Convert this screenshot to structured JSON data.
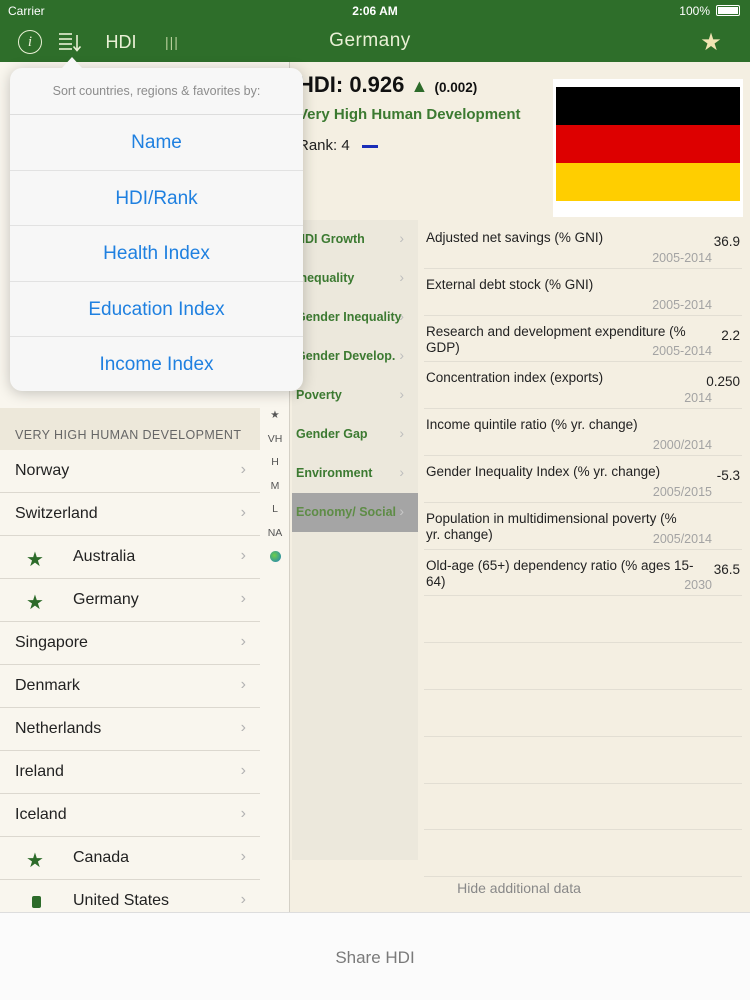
{
  "status": {
    "carrier": "Carrier",
    "time": "2:06 AM",
    "battery": "100%"
  },
  "nav": {
    "hdi_tab": "HDI",
    "title": "Germany",
    "info_glyph": "i",
    "bars_glyph": "|||",
    "star_glyph": "★"
  },
  "sort_popover": {
    "hint": "Sort countries, regions & favorites by:",
    "options": [
      "Name",
      "HDI/Rank",
      "Health Index",
      "Education Index",
      "Income Index"
    ]
  },
  "list": {
    "section_header": "VERY HIGH HUMAN DEVELOPMENT",
    "chevron": "›",
    "rows": [
      {
        "name": "Norway",
        "marker": ""
      },
      {
        "name": "Switzerland",
        "marker": ""
      },
      {
        "name": "Australia",
        "marker": "star"
      },
      {
        "name": "Germany",
        "marker": "star"
      },
      {
        "name": "Singapore",
        "marker": ""
      },
      {
        "name": "Denmark",
        "marker": ""
      },
      {
        "name": "Netherlands",
        "marker": ""
      },
      {
        "name": "Ireland",
        "marker": ""
      },
      {
        "name": "Iceland",
        "marker": ""
      },
      {
        "name": "Canada",
        "marker": "star"
      },
      {
        "name": "United States",
        "marker": "flag"
      }
    ],
    "index_strip": [
      "★",
      "VH",
      "H",
      "M",
      "L",
      "NA"
    ]
  },
  "detail": {
    "hdi_label": "HDI: 0.926",
    "hdi_arrow": "▲",
    "hdi_change": "(0.002)",
    "dev_level": "Very High Human Development",
    "rank_label": "Rank: 4",
    "flag_colors": [
      "#000000",
      "#dd0000",
      "#ffce00"
    ],
    "categories": [
      {
        "label": "HDI Growth",
        "active": false
      },
      {
        "label": "Inequality",
        "active": false
      },
      {
        "label": "Gender Inequality",
        "active": false
      },
      {
        "label": "Gender Develop.",
        "active": false
      },
      {
        "label": "Poverty",
        "active": false
      },
      {
        "label": "Gender Gap",
        "active": false
      },
      {
        "label": "Environment",
        "active": false
      },
      {
        "label": "Economy/ Social",
        "active": true
      }
    ],
    "indicators": [
      {
        "label": "Adjusted net savings (% GNI)",
        "value": "36.9",
        "years": "2005-2014"
      },
      {
        "label": "External debt stock (% GNI)",
        "value": "",
        "years": "2005-2014"
      },
      {
        "label": "Research and development expenditure (% GDP)",
        "value": "2.2",
        "years": "2005-2014"
      },
      {
        "label": "Concentration index (exports)",
        "value": "0.250",
        "years": "2014"
      },
      {
        "label": "Income quintile ratio (% yr. change)",
        "value": "",
        "years": "2000/2014"
      },
      {
        "label": "Gender Inequality Index (% yr. change)",
        "value": "-5.3",
        "years": "2005/2015"
      },
      {
        "label": "Population in multidimensional poverty (% yr. change)",
        "value": "",
        "years": "2005/2014"
      },
      {
        "label": "Old-age (65+) dependency ratio (% ages 15-64)",
        "value": "36.5",
        "years": "2030"
      }
    ],
    "hide_data_label": "Hide additional data"
  },
  "bottom": {
    "share_label": "Share HDI"
  }
}
